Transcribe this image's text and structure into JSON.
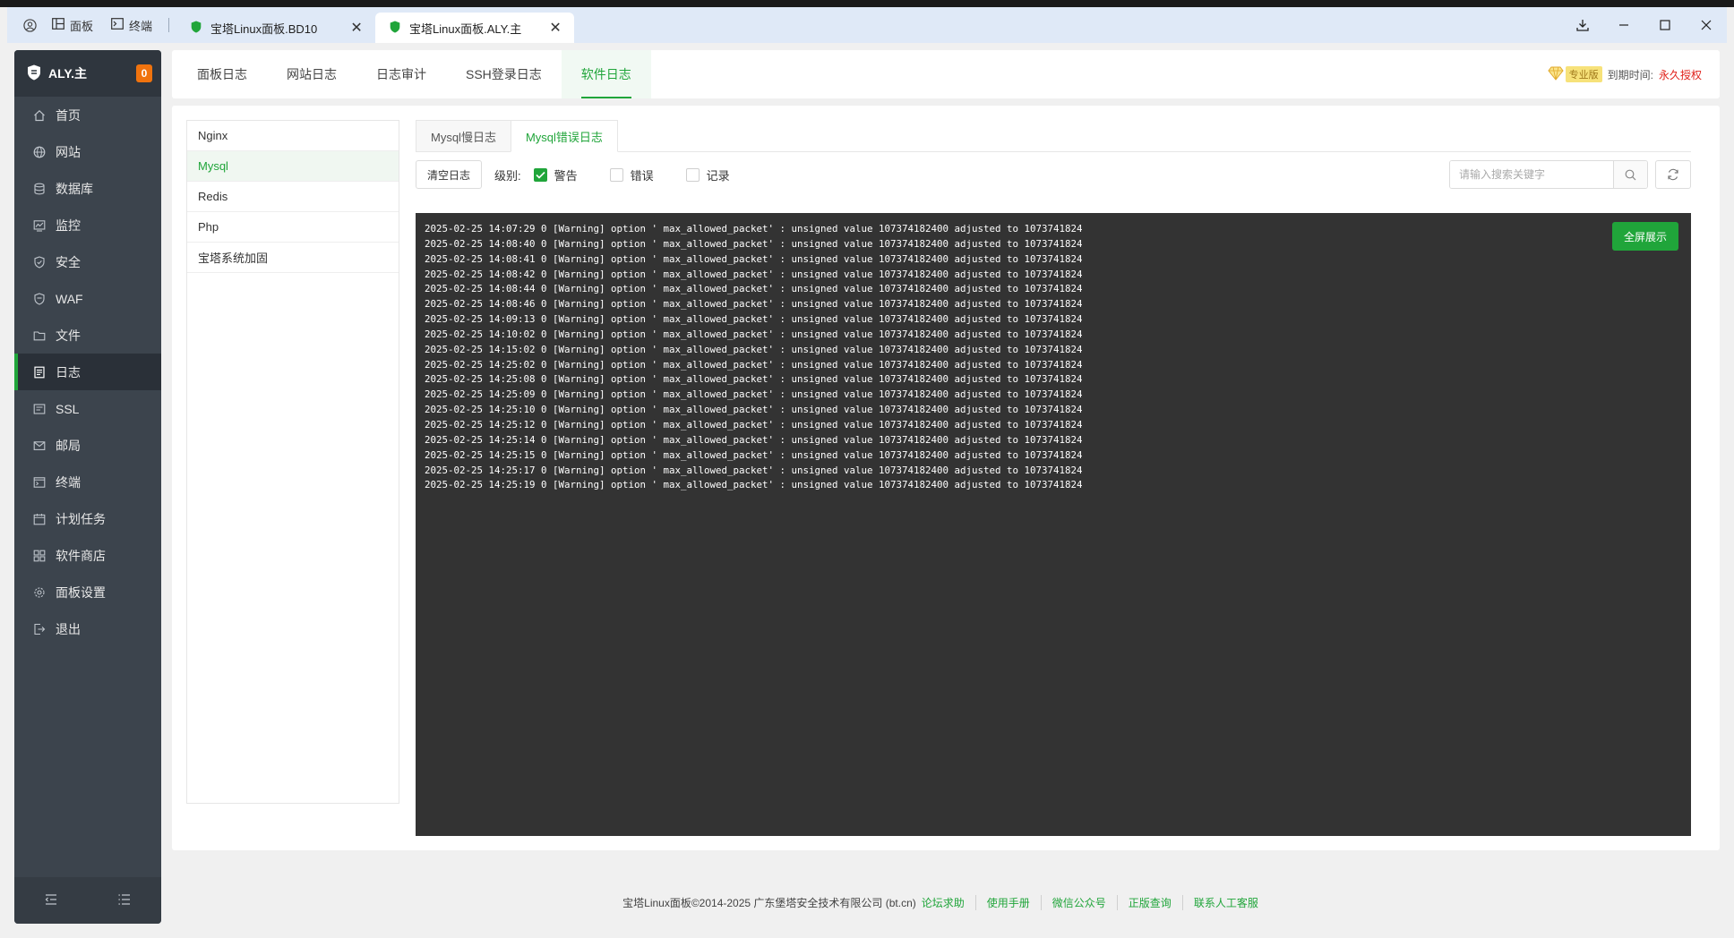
{
  "titlebar": {
    "panel_label": "面板",
    "terminal_label": "终端",
    "tabs": [
      {
        "title": "宝塔Linux面板.BD10"
      },
      {
        "title": "宝塔Linux面板.ALY.主"
      }
    ]
  },
  "sidebar": {
    "title": "ALY.主",
    "badge": "0",
    "items": [
      {
        "label": "首页",
        "icon": "home-icon"
      },
      {
        "label": "网站",
        "icon": "globe-icon"
      },
      {
        "label": "数据库",
        "icon": "database-icon"
      },
      {
        "label": "监控",
        "icon": "monitor-icon"
      },
      {
        "label": "安全",
        "icon": "shield-icon"
      },
      {
        "label": "WAF",
        "icon": "waf-shield-icon"
      },
      {
        "label": "文件",
        "icon": "folder-icon"
      },
      {
        "label": "日志",
        "icon": "log-icon"
      },
      {
        "label": "SSL",
        "icon": "ssl-icon"
      },
      {
        "label": "邮局",
        "icon": "mail-icon"
      },
      {
        "label": "终端",
        "icon": "terminal-icon"
      },
      {
        "label": "计划任务",
        "icon": "calendar-icon"
      },
      {
        "label": "软件商店",
        "icon": "grid-icon"
      },
      {
        "label": "面板设置",
        "icon": "gear-icon"
      },
      {
        "label": "退出",
        "icon": "logout-icon"
      }
    ],
    "active": "日志"
  },
  "topnav": {
    "items": [
      "面板日志",
      "网站日志",
      "日志审计",
      "SSH登录日志",
      "软件日志"
    ],
    "active": "软件日志",
    "pro_label": "专业版",
    "expire_label": "到期时间:",
    "expire_value": "永久授权"
  },
  "software_list": {
    "items": [
      "Nginx",
      "Mysql",
      "Redis",
      "Php",
      "宝塔系统加固"
    ],
    "active": "Mysql"
  },
  "subtabs": {
    "items": [
      "Mysql慢日志",
      "Mysql错误日志"
    ],
    "active": "Mysql错误日志"
  },
  "toolbar": {
    "clear_label": "清空日志",
    "level_label": "级别:",
    "levels": [
      {
        "label": "警告",
        "checked": true
      },
      {
        "label": "错误",
        "checked": false
      },
      {
        "label": "记录",
        "checked": false
      }
    ],
    "search_placeholder": "请输入搜索关键字"
  },
  "log": {
    "fullscreen_label": "全屏展示",
    "lines": [
      "2025-02-25 14:07:29 0 [Warning] option ' max_allowed_packet' : unsigned value 107374182400 adjusted to 1073741824",
      "2025-02-25 14:08:40 0 [Warning] option ' max_allowed_packet' : unsigned value 107374182400 adjusted to 1073741824",
      "2025-02-25 14:08:41 0 [Warning] option ' max_allowed_packet' : unsigned value 107374182400 adjusted to 1073741824",
      "2025-02-25 14:08:42 0 [Warning] option ' max_allowed_packet' : unsigned value 107374182400 adjusted to 1073741824",
      "2025-02-25 14:08:44 0 [Warning] option ' max_allowed_packet' : unsigned value 107374182400 adjusted to 1073741824",
      "2025-02-25 14:08:46 0 [Warning] option ' max_allowed_packet' : unsigned value 107374182400 adjusted to 1073741824",
      "2025-02-25 14:09:13 0 [Warning] option ' max_allowed_packet' : unsigned value 107374182400 adjusted to 1073741824",
      "2025-02-25 14:10:02 0 [Warning] option ' max_allowed_packet' : unsigned value 107374182400 adjusted to 1073741824",
      "2025-02-25 14:15:02 0 [Warning] option ' max_allowed_packet' : unsigned value 107374182400 adjusted to 1073741824",
      "2025-02-25 14:25:02 0 [Warning] option ' max_allowed_packet' : unsigned value 107374182400 adjusted to 1073741824",
      "2025-02-25 14:25:08 0 [Warning] option ' max_allowed_packet' : unsigned value 107374182400 adjusted to 1073741824",
      "2025-02-25 14:25:09 0 [Warning] option ' max_allowed_packet' : unsigned value 107374182400 adjusted to 1073741824",
      "2025-02-25 14:25:10 0 [Warning] option ' max_allowed_packet' : unsigned value 107374182400 adjusted to 1073741824",
      "2025-02-25 14:25:12 0 [Warning] option ' max_allowed_packet' : unsigned value 107374182400 adjusted to 1073741824",
      "2025-02-25 14:25:14 0 [Warning] option ' max_allowed_packet' : unsigned value 107374182400 adjusted to 1073741824",
      "2025-02-25 14:25:15 0 [Warning] option ' max_allowed_packet' : unsigned value 107374182400 adjusted to 1073741824",
      "2025-02-25 14:25:17 0 [Warning] option ' max_allowed_packet' : unsigned value 107374182400 adjusted to 1073741824",
      "2025-02-25 14:25:19 0 [Warning] option ' max_allowed_packet' : unsigned value 107374182400 adjusted to 1073741824"
    ]
  },
  "footer": {
    "copyright": "宝塔Linux面板©2014-2025 广东堡塔安全技术有限公司 (bt.cn)",
    "links": [
      "论坛求助",
      "使用手册",
      "微信公众号",
      "正版查询",
      "联系人工客服"
    ]
  },
  "colors": {
    "accent": "#20a53a",
    "sidebar_bg": "#3c444d",
    "log_bg": "#333333",
    "badge": "#f0730e",
    "expire": "#e0201a"
  }
}
